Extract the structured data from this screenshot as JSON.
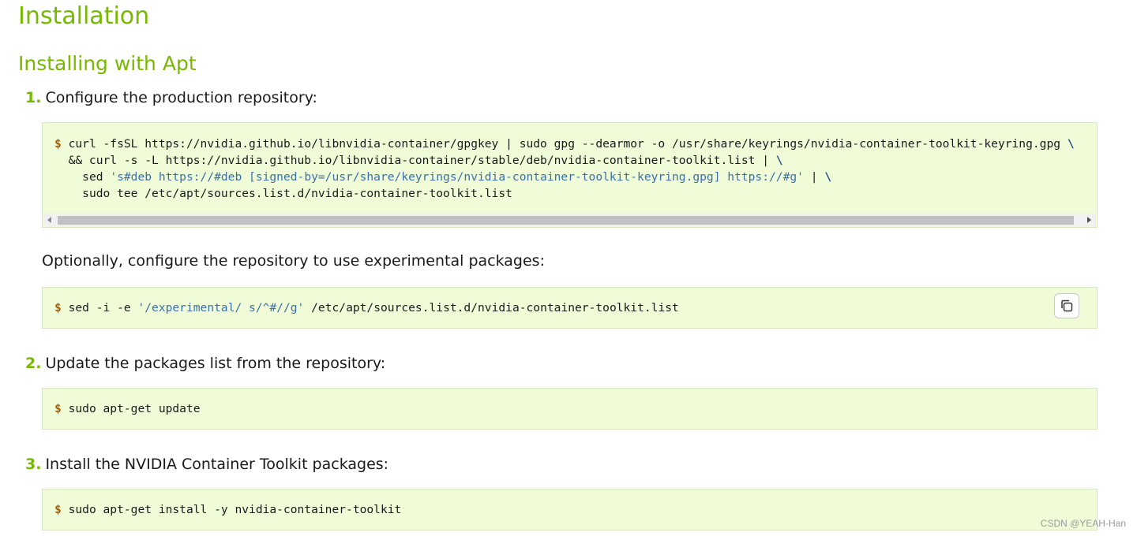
{
  "headings": {
    "title": "Installation",
    "subtitle": "Installing with Apt"
  },
  "steps": [
    {
      "number": "1.",
      "text": "Configure the production repository:"
    },
    {
      "number": "2.",
      "text": "Update the packages list from the repository:"
    },
    {
      "number": "3.",
      "text": "Install the NVIDIA Container Toolkit packages:"
    }
  ],
  "optional_text": "Optionally, configure the repository to use experimental packages:",
  "code": {
    "prompt": "$",
    "block1": {
      "line1": "curl -fsSL https://nvidia.github.io/libnvidia-container/gpgkey | sudo gpg --dearmor -o /usr/share/keyrings/nvidia-container-toolkit-keyring.gpg",
      "line1_cont": "\\",
      "line2": "&& curl -s -L https://nvidia.github.io/libnvidia-container/stable/deb/nvidia-container-toolkit.list |",
      "line2_cont": "\\",
      "line3_cmd": "sed",
      "line3_str": "'s#deb https://#deb [signed-by=/usr/share/keyrings/nvidia-container-toolkit-keyring.gpg] https://#g'",
      "line3_pipe": "|",
      "line3_cont": "\\",
      "line4": "sudo tee /etc/apt/sources.list.d/nvidia-container-toolkit.list"
    },
    "block2": {
      "cmd": "sed -i -e",
      "str": "'/experimental/ s/^#//g'",
      "rest": "/etc/apt/sources.list.d/nvidia-container-toolkit.list"
    },
    "block3": "sudo apt-get update",
    "block4": "sudo apt-get install -y nvidia-container-toolkit"
  },
  "watermark": "CSDN @YEAH-Han",
  "icons": {
    "copy": "copy-icon"
  },
  "colors": {
    "accent": "#76b900",
    "code_bg": "#f0fcd8",
    "prompt": "#b35c00",
    "string": "#3b6fa8"
  }
}
